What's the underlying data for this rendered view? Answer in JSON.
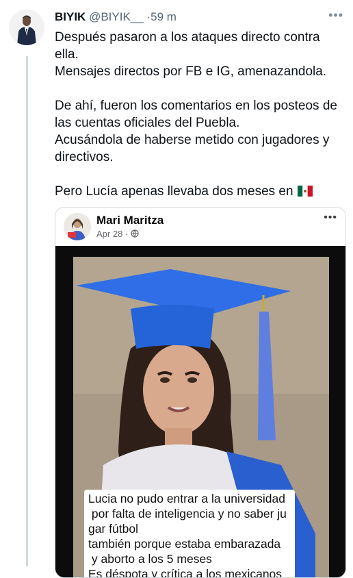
{
  "tweet": {
    "author_name": "BIYIK",
    "handle": "@BIYIK__",
    "separator": "·",
    "time": "59 m",
    "more": "•••",
    "paragraphs": [
      [
        "Después pasaron a los ataques directo contra ella.",
        "Mensajes directos por FB e IG, amenazandola."
      ],
      [
        "De ahí, fueron los comentarios en los posteos de las cuentas oficiales del Puebla.",
        "Acusándola de haberse metido con jugadores y directivos."
      ],
      [
        "Pero Lucía apenas llevaba dos meses en"
      ]
    ],
    "flag_icon": "mexico-flag-icon"
  },
  "embedded_post": {
    "author_name": "Mari Maritza",
    "date": "Apr 28",
    "separator": "·",
    "privacy_icon": "globe-icon",
    "more": "•••",
    "image_overlay_text": [
      "Lucia no pudo entrar a la universidad",
      " por falta de inteligencia y no saber ju",
      "gar fútbol",
      "también porque estaba embarazada",
      " y aborto a los 5 meses",
      "Es déspota y crítica a los mexicanos"
    ]
  },
  "colors": {
    "text": "#0f1419",
    "secondary": "#536471",
    "divider": "#cfd9de",
    "cap_blue": "#2f6ee6"
  }
}
